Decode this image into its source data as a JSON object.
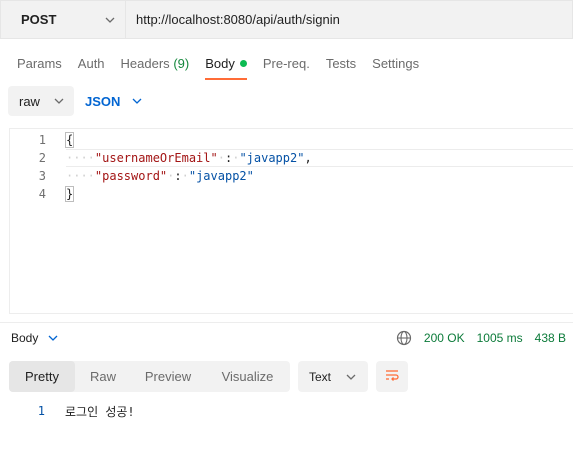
{
  "request": {
    "method": "POST",
    "url": "http://localhost:8080/api/auth/signin"
  },
  "tabs": [
    {
      "label": "Params"
    },
    {
      "label": "Auth"
    },
    {
      "label": "Headers",
      "count": "(9)"
    },
    {
      "label": "Body",
      "active": true
    },
    {
      "label": "Pre-req."
    },
    {
      "label": "Tests"
    },
    {
      "label": "Settings"
    }
  ],
  "body_type": {
    "mode": "raw",
    "language": "JSON"
  },
  "editor": {
    "lines": [
      {
        "num": "1",
        "open": "{"
      },
      {
        "num": "2",
        "key": "\"usernameOrEmail\"",
        "sep": ":",
        "value": "\"javapp2\"",
        "trail": ","
      },
      {
        "num": "3",
        "key": "\"password\"",
        "sep": ":",
        "value": "\"javapp2\"",
        "trail": ""
      },
      {
        "num": "4",
        "close": "}"
      }
    ]
  },
  "response": {
    "section_label": "Body",
    "status": "200 OK",
    "time": "1005 ms",
    "size": "438 B",
    "view_tabs": [
      "Pretty",
      "Raw",
      "Preview",
      "Visualize"
    ],
    "active_view": "Pretty",
    "format": "Text",
    "body_lines": [
      {
        "num": "1",
        "text": "로그인 성공!"
      }
    ]
  },
  "colors": {
    "accent_orange": "#ff6c37",
    "status_green": "#0c7b3a",
    "json_blue": "#0265d2",
    "dot_green": "#0cbb52"
  },
  "icons": [
    "chevron-down-icon",
    "globe-icon",
    "wrap-lines-icon"
  ]
}
